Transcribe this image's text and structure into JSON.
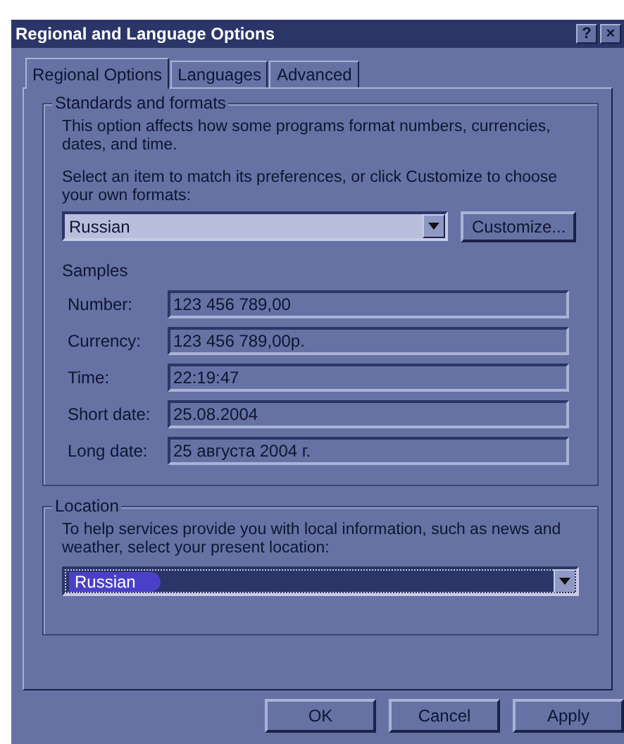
{
  "window": {
    "title": "Regional and Language Options",
    "help_button": "?",
    "close_button": "×"
  },
  "tabs": [
    {
      "label": "Regional Options",
      "selected": true
    },
    {
      "label": "Languages",
      "selected": false
    },
    {
      "label": "Advanced",
      "selected": false
    }
  ],
  "standards": {
    "title": "Standards and formats",
    "description": "This option affects how some programs format numbers, currencies, dates, and time.",
    "prompt": "Select an item to match its preferences, or click Customize to choose your own formats:",
    "format_value": "Russian",
    "customize_button": "Customize...",
    "samples_label": "Samples",
    "samples": [
      {
        "label": "Number:",
        "value": "123 456 789,00"
      },
      {
        "label": "Currency:",
        "value": "123 456 789,00р."
      },
      {
        "label": "Time:",
        "value": "22:19:47"
      },
      {
        "label": "Short date:",
        "value": "25.08.2004"
      },
      {
        "label": "Long date:",
        "value": "25 августа 2004 г."
      }
    ]
  },
  "location": {
    "title": "Location",
    "prompt": "To help services provide you with local information, such as news and weather, select your present location:",
    "value": "Russian",
    "focused": true
  },
  "buttons": [
    {
      "label": "OK"
    },
    {
      "label": "Cancel"
    },
    {
      "label": "Apply"
    }
  ]
}
